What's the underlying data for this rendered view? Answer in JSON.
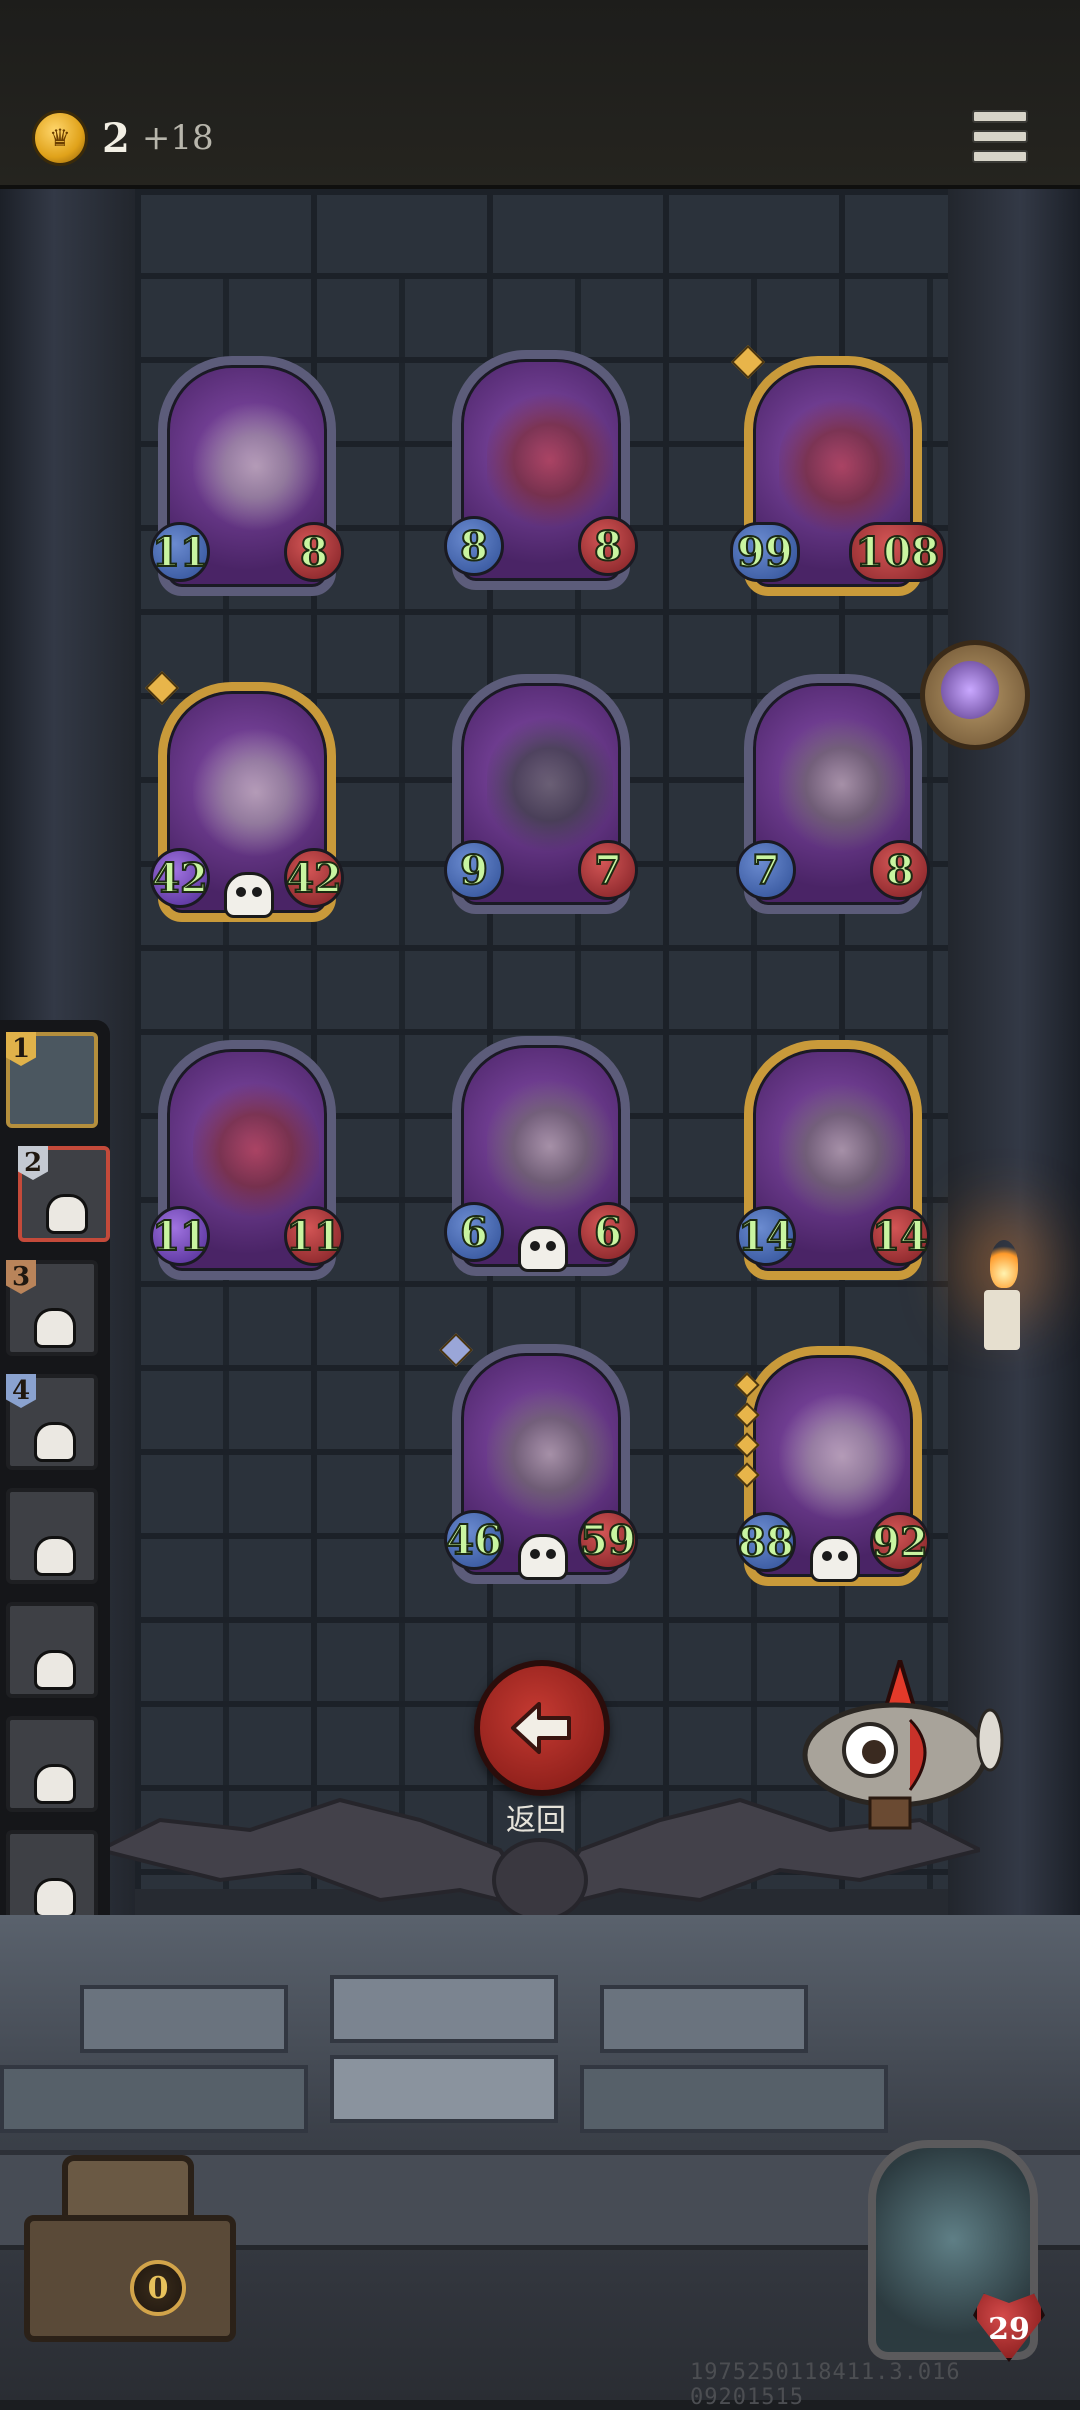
{
  "hud": {
    "gold": "2",
    "gold_income": "+18"
  },
  "board": {
    "cards": [
      {
        "id": "dragon",
        "atk": "11",
        "hp": "8",
        "frame": "silver"
      },
      {
        "id": "jester",
        "atk": "8",
        "hp": "8",
        "frame": "silver"
      },
      {
        "id": "wyrm",
        "atk": "99",
        "hp": "108",
        "frame": "gold"
      },
      {
        "id": "bone-dragon",
        "atk": "42",
        "hp": "42",
        "frame": "gold"
      },
      {
        "id": "skull-reaper",
        "atk": "9",
        "hp": "7",
        "frame": "silver"
      },
      {
        "id": "beast",
        "atk": "7",
        "hp": "8",
        "frame": "silver"
      },
      {
        "id": "hooded-assassin",
        "atk": "11",
        "hp": "11",
        "frame": "silver"
      },
      {
        "id": "robot-bell",
        "atk": "6",
        "hp": "6",
        "frame": "silver"
      },
      {
        "id": "airship",
        "atk": "14",
        "hp": "14",
        "frame": "gold"
      },
      {
        "id": "clockwork",
        "atk": "46",
        "hp": "59",
        "frame": "silver"
      },
      {
        "id": "cannon",
        "atk": "88",
        "hp": "92",
        "frame": "gold"
      }
    ]
  },
  "back_button": {
    "label": "返回"
  },
  "roster": {
    "ranks": [
      "1",
      "2",
      "3",
      "4"
    ]
  },
  "chest": {
    "count": "0"
  },
  "hero": {
    "hp": "29"
  },
  "build": "1975250118411.3.016 09201515"
}
